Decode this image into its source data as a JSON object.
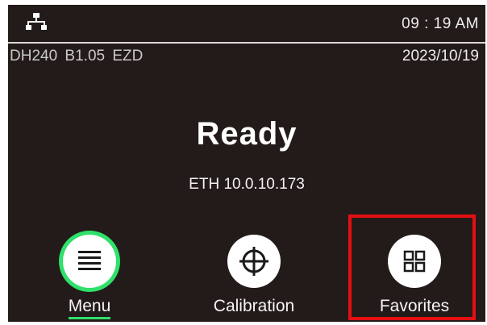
{
  "header": {
    "network_icon": "network-icon",
    "time": "09 : 19 AM",
    "model_info": "DH240 B1.05 EZD",
    "date": "2023/10/19"
  },
  "main": {
    "status": "Ready",
    "network_address": "ETH 10.0.10.173"
  },
  "buttons": {
    "menu": {
      "label": "Menu",
      "icon": "hamburger-icon",
      "focus_color": "#2fe06a"
    },
    "calibration": {
      "label": "Calibration",
      "icon": "crosshair-icon"
    },
    "favorites": {
      "label": "Favorites",
      "icon": "grid-icon",
      "selected": true,
      "highlight_color": "#e50f12"
    }
  }
}
